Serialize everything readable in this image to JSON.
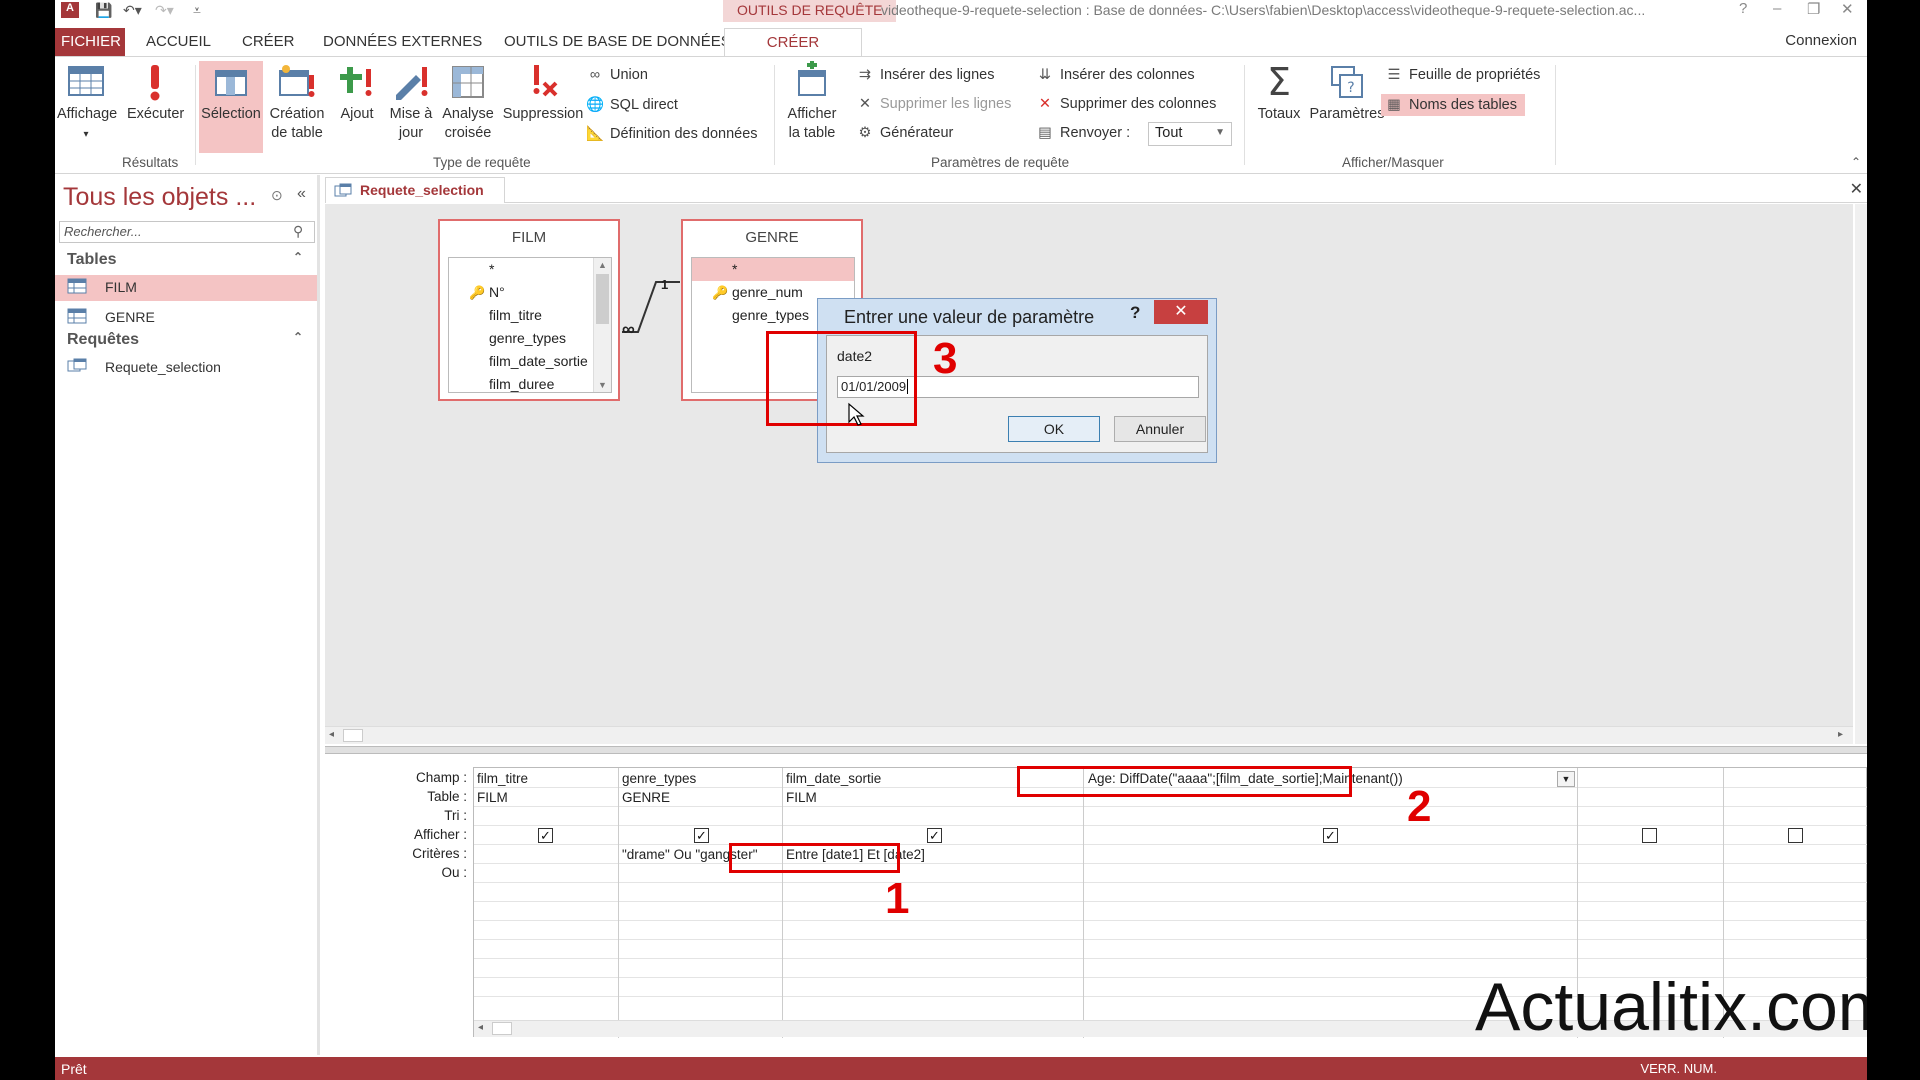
{
  "titlebar": {
    "context_label": "OUTILS DE REQUÊTE",
    "window_title": "videotheque-9-requete-selection : Base de données- C:\\Users\\fabien\\Desktop\\access\\videotheque-9-requete-selection.ac...",
    "help": "?",
    "minimize": "–",
    "restore": "❐",
    "close": "✕"
  },
  "tabs": {
    "fichier": "FICHIER",
    "accueil": "ACCUEIL",
    "creer": "CRÉER",
    "donnees_externes": "DONNÉES EXTERNES",
    "outils_bdd": "OUTILS DE BASE DE DONNÉES",
    "creer_ctx": "CRÉER",
    "connexion": "Connexion"
  },
  "ribbon": {
    "affichage": "Affichage",
    "executer": "Exécuter",
    "selection": "Sélection",
    "creation_table": "Création de table",
    "ajout": "Ajout",
    "mise_a_jour": "Mise à jour",
    "analyse_croisee": "Analyse croisée",
    "suppression": "Suppression",
    "union": "Union",
    "sql_direct": "SQL direct",
    "definition_donnees": "Définition des données",
    "afficher_table": "Afficher la table",
    "inserer_lignes": "Insérer des lignes",
    "supprimer_lignes": "Supprimer les lignes",
    "generateur": "Générateur",
    "inserer_colonnes": "Insérer des colonnes",
    "supprimer_colonnes": "Supprimer des colonnes",
    "renvoyer": "Renvoyer :",
    "renvoyer_value": "Tout",
    "totaux": "Totaux",
    "parametres": "Paramètres",
    "feuille_proprietes": "Feuille de propriétés",
    "noms_tables": "Noms des tables",
    "groups": {
      "resultats": "Résultats",
      "type_requete": "Type de requête",
      "parametres_requete": "Paramètres de requête",
      "afficher_masquer": "Afficher/Masquer"
    }
  },
  "nav": {
    "title": "Tous les objets ...",
    "search_placeholder": "Rechercher...",
    "tables_header": "Tables",
    "tables": [
      "FILM",
      "GENRE"
    ],
    "requetes_header": "Requêtes",
    "requetes": [
      "Requete_selection"
    ]
  },
  "document": {
    "tab_label": "Requete_selection"
  },
  "design": {
    "film_table": {
      "title": "FILM",
      "fields": [
        "*",
        "N°",
        "film_titre",
        "genre_types",
        "film_date_sortie",
        "film_duree"
      ]
    },
    "genre_table": {
      "title": "GENRE",
      "fields": [
        "*",
        "genre_num",
        "genre_types"
      ]
    },
    "relation_one": "1",
    "relation_many": "∞"
  },
  "grid": {
    "row_labels": [
      "Champ :",
      "Table :",
      "Tri :",
      "Afficher :",
      "Critères :",
      "Ou :"
    ],
    "columns": [
      {
        "champ": "film_titre",
        "table": "FILM",
        "afficher": true,
        "criteres": ""
      },
      {
        "champ": "genre_types",
        "table": "GENRE",
        "afficher": true,
        "criteres": "\"drame\" Ou \"gangster\""
      },
      {
        "champ": "film_date_sortie",
        "table": "FILM",
        "afficher": true,
        "criteres": "Entre [date1] Et [date2]"
      },
      {
        "champ": "Age: DiffDate(\"aaaa\";[film_date_sortie];Maintenant())",
        "table": "",
        "afficher": true,
        "criteres": ""
      },
      {
        "champ": "",
        "table": "",
        "afficher": false,
        "criteres": ""
      },
      {
        "champ": "",
        "table": "",
        "afficher": false,
        "criteres": ""
      }
    ]
  },
  "dialog": {
    "title": "Entrer une valeur de paramètre",
    "help": "?",
    "close": "✕",
    "label": "date2",
    "value": "01/01/2009",
    "ok": "OK",
    "cancel": "Annuler"
  },
  "annotations": [
    "1",
    "2",
    "3"
  ],
  "status": {
    "left": "Prêt",
    "right": "VERR. NUM."
  },
  "watermark": "Actualitix.com",
  "colors": {
    "accent": "#a4373a",
    "highlight": "#f4c4c4",
    "annotation": "#e00000"
  }
}
